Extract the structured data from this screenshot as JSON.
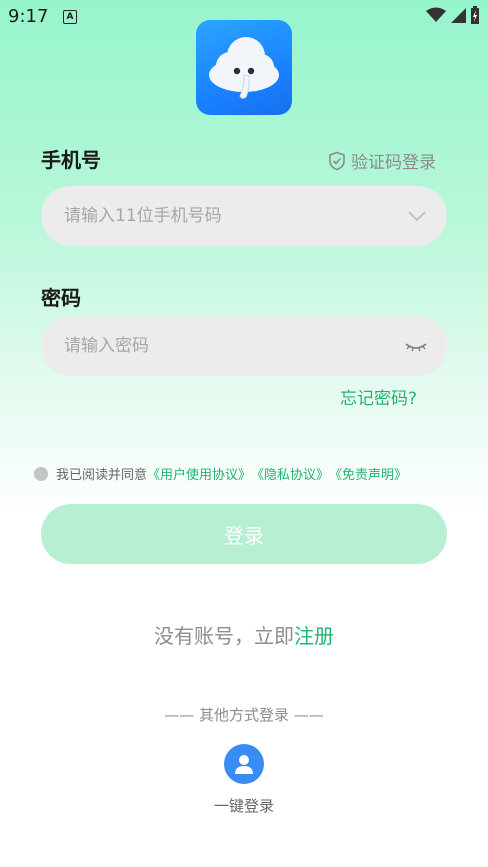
{
  "status_bar": {
    "time": "9:17",
    "notification_icon": "a-icon",
    "wifi_icon": "wifi-icon",
    "signal_icon": "signal-icon",
    "battery_icon": "battery-charging-icon"
  },
  "app": {
    "icon": "cloud-app-icon"
  },
  "phone": {
    "label": "手机号",
    "placeholder": "请输入11位手机号码",
    "dropdown_icon": "chevron-down-icon"
  },
  "code_login": {
    "icon": "shield-icon",
    "label": "验证码登录"
  },
  "password": {
    "label": "密码",
    "placeholder": "请输入密码",
    "toggle_icon": "eye-closed-icon"
  },
  "forgot_label": "忘记密码?",
  "agreement": {
    "prefix": "我已阅读并同意",
    "user_agreement": "《用户使用协议》",
    "privacy": "《隐私协议》",
    "disclaimer": "《免责声明》"
  },
  "login_button": "登录",
  "register": {
    "prefix": "没有账号，立即",
    "link": "注册"
  },
  "other_login": "—— 其他方式登录 ——",
  "one_key": {
    "icon": "user-icon",
    "label": "一键登录"
  },
  "colors": {
    "accent": "#1fb56e",
    "button_disabled": "#b6efd1",
    "gradient_top": "#96f5cc",
    "app_icon": "#1a83ff"
  }
}
